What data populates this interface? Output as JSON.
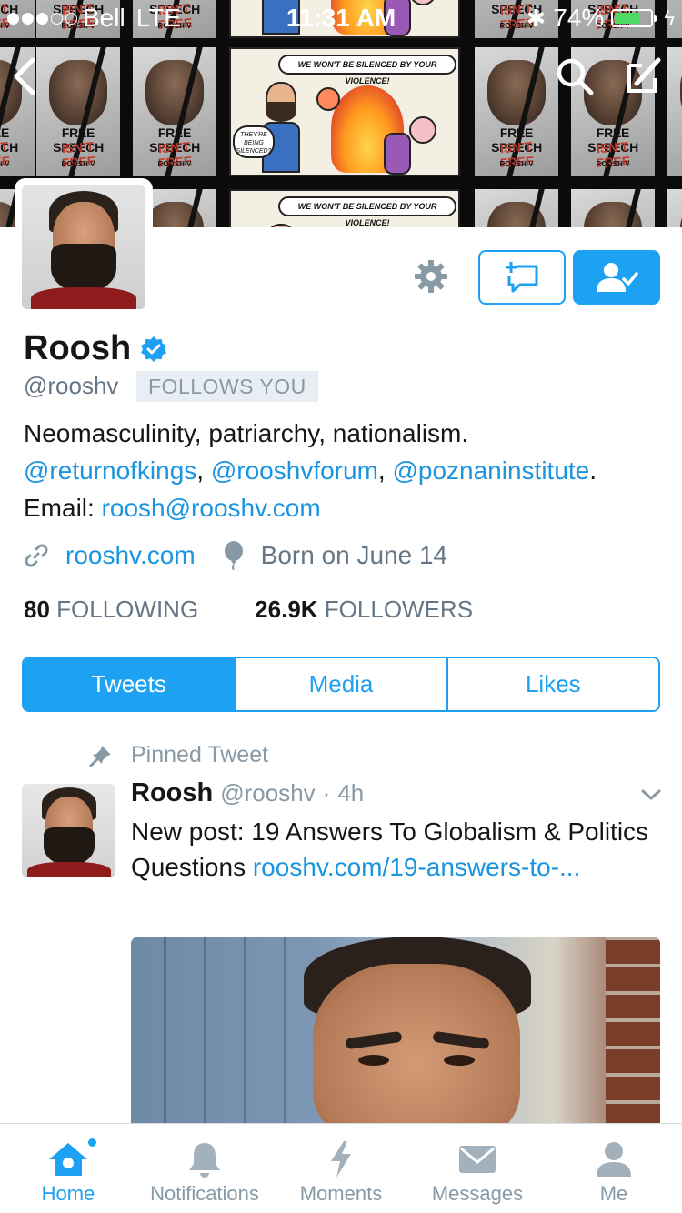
{
  "status_bar": {
    "carrier": "Bell",
    "network": "LTE",
    "time": "11:31 AM",
    "battery": "74%",
    "battery_level": 0.74
  },
  "banner": {
    "poster_line1": "FREE SPEECH",
    "poster_line2": "ISN'T FREE",
    "poster_line3": "ROOSH V",
    "comic_bubble": "WE WON'T BE SILENCED BY YOUR VIOLENCE!",
    "comic_bubble_small": "THEY'RE BEING SILENCED?"
  },
  "profile": {
    "name": "Roosh",
    "handle": "@rooshv",
    "follows_you": "FOLLOWS YOU",
    "bio_line1": "Neomasculinity, patriarchy, nationalism.",
    "bio_mentions": [
      "@returnofkings",
      "@rooshvforum",
      "@poznaninstitute"
    ],
    "bio_sep1": ", ",
    "bio_sep2": ", ",
    "bio_end": ".",
    "email_label": "Email: ",
    "email": "roosh@rooshv.com",
    "website": "rooshv.com",
    "birthday": "Born on June 14",
    "following_count": "80",
    "following_label": "FOLLOWING",
    "followers_count": "26.9K",
    "followers_label": "FOLLOWERS"
  },
  "tabs": [
    "Tweets",
    "Media",
    "Likes"
  ],
  "tweet": {
    "pinned_label": "Pinned Tweet",
    "author": "Roosh",
    "handle": "@rooshv",
    "sep": "·",
    "age": "4h",
    "text": "New post: 19 Answers To Globalism & Politics Questions ",
    "link": "rooshv.com/19-answers-to-..."
  },
  "tab_bar": [
    {
      "label": "Home",
      "icon": "home-icon"
    },
    {
      "label": "Notifications",
      "icon": "bell-icon"
    },
    {
      "label": "Moments",
      "icon": "lightning-icon"
    },
    {
      "label": "Messages",
      "icon": "envelope-icon"
    },
    {
      "label": "Me",
      "icon": "person-icon"
    }
  ],
  "colors": {
    "accent": "#1da1f2",
    "link": "#1b95e0",
    "muted": "#657786",
    "verified": "#1da1f2"
  }
}
